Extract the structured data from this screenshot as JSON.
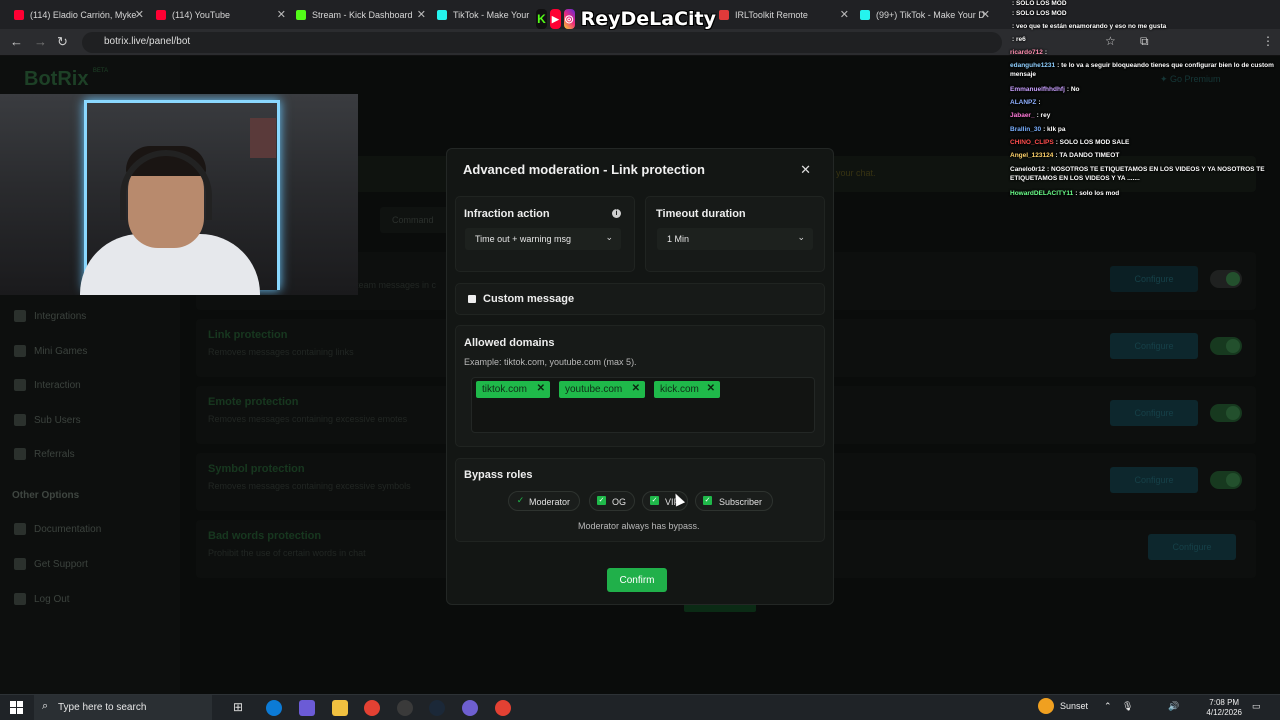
{
  "browser": {
    "tabs": [
      {
        "title": "(114) Eladio Carrión, Myke",
        "favicon_color": "#ff0033"
      },
      {
        "title": "(114) YouTube",
        "favicon_color": "#ff0033"
      },
      {
        "title": "Stream - Kick Dashboard",
        "favicon_color": "#53fc18"
      },
      {
        "title": "TikTok - Make Your Da",
        "favicon_color": "#25f4ee"
      },
      {
        "title": "IRLToolkit Remote",
        "favicon_color": "#e03a3a"
      },
      {
        "title": "(99+) TikTok - Make Your D",
        "favicon_color": "#25f4ee"
      }
    ],
    "url": "botrix.live/panel/bot"
  },
  "overlay": {
    "stream_name": "ReyDeLaCity"
  },
  "chat": [
    {
      "user": "",
      "msg": ": SOLO LOS MOD",
      "color": "#ff5a5a"
    },
    {
      "user": "",
      "msg": ": SOLO LOS MOD",
      "color": "#ff5a5a"
    },
    {
      "user": "",
      "msg": ": veo que te están enamorando y eso no me gusta",
      "color": "#ff5a5a"
    },
    {
      "user": "",
      "msg": ": re6",
      "color": "#ff5a5a"
    },
    {
      "user": "ricardo712",
      "msg": ":",
      "color": "#ff8fb0"
    },
    {
      "user": "edanguhe1231",
      "msg": ": te lo va a seguir bloqueando tienes que configurar bien lo de custom mensaje",
      "color": "#8fd0ff"
    },
    {
      "user": "Emmanuelfhhdhfj",
      "msg": ": No",
      "color": "#c9a0ff"
    },
    {
      "user": "ALANPZ",
      "msg": ":",
      "color": "#8fb0ff"
    },
    {
      "user": "Jabaer_",
      "msg": ": rey",
      "color": "#ff7ad9"
    },
    {
      "user": "Brallin_30",
      "msg": ": klk pa",
      "color": "#7ab0ff"
    },
    {
      "user": "CHINO_CLIPS",
      "msg": ": SOLO LOS MOD SALE",
      "color": "#ff4d4d"
    },
    {
      "user": "Angel_123124",
      "msg": ": TA DANDO TIMEOT",
      "color": "#ffd36b"
    },
    {
      "user": "Canelo0r12",
      "msg": ": NOSOTROS TE ETIQUETAMOS EN LOS VIDEOS Y YA NOSOTROS TE ETIQUETAMOS EN LOS VIDEOS Y YA .......",
      "color": "#ffffff"
    },
    {
      "user": "HowardDELACITY11",
      "msg": ": solo los mod",
      "color": "#6bff8a"
    }
  ],
  "app": {
    "logo": "BotRix",
    "logo_badge": "BETA",
    "sidebar": [
      {
        "label": "Integrations"
      },
      {
        "label": "Mini Games"
      },
      {
        "label": "Interaction"
      },
      {
        "label": "Sub Users"
      },
      {
        "label": "Referrals"
      }
    ],
    "sidebar_section": "Other Options",
    "sidebar_other": [
      {
        "label": "Documentation"
      },
      {
        "label": "Get Support"
      },
      {
        "label": "Log Out"
      }
    ],
    "go_premium": "Go Premium",
    "tab_commands": "Command",
    "banner_hint": "your chat.",
    "bg_snippet": "team messages in c",
    "cards": [
      {
        "title": "",
        "desc": "",
        "button": "Configure",
        "enabled": false
      },
      {
        "title": "Link protection",
        "desc": "Removes messages containing links",
        "button": "Configure",
        "enabled": true
      },
      {
        "title": "Emote protection",
        "desc": "Removes messages containing excessive emotes",
        "button": "Configure",
        "enabled": true
      },
      {
        "title": "Symbol protection",
        "desc": "Removes messages containing excessive symbols",
        "button": "Configure",
        "enabled": true
      },
      {
        "title": "Bad words protection",
        "desc": "Prohibit the use of certain words in chat",
        "button": "Configure",
        "enabled": false
      }
    ]
  },
  "modal": {
    "title": "Advanced moderation - Link protection",
    "infraction_label": "Infraction action",
    "infraction_value": "Time out + warning msg",
    "timeout_label": "Timeout duration",
    "timeout_value": "1 Min",
    "custom_message_label": "Custom message",
    "custom_message_checked": false,
    "allowed_domains_label": "Allowed domains",
    "allowed_domains_hint": "Example: tiktok.com, youtube.com (max 5).",
    "domains": [
      "tiktok.com",
      "youtube.com",
      "kick.com"
    ],
    "bypass_label": "Bypass roles",
    "roles": [
      {
        "label": "Moderator",
        "checked": true
      },
      {
        "label": "OG",
        "checked": true
      },
      {
        "label": "VIP",
        "checked": true
      },
      {
        "label": "Subscriber",
        "checked": true
      }
    ],
    "bypass_note": "Moderator always has bypass.",
    "confirm_label": "Confirm"
  },
  "taskbar": {
    "search_placeholder": "Type here to search",
    "weather": "Sunset",
    "time": "7:08 PM",
    "date": "4/12/2026"
  }
}
